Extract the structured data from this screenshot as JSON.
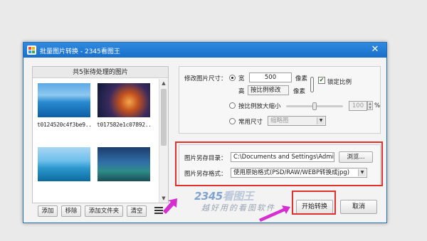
{
  "window": {
    "title": "批量图片转换 - 2345看图王",
    "close_glyph": "✕"
  },
  "file_list": {
    "header": "共5张待处理的图片",
    "items": [
      {
        "name": "t0124520c4f3be9..."
      },
      {
        "name": "t017582e1c07892..."
      },
      {
        "name": ""
      },
      {
        "name": ""
      }
    ],
    "buttons": {
      "add": "添加",
      "remove": "移除",
      "add_folder": "添加文件夹",
      "clear": "清空"
    }
  },
  "resize": {
    "label": "修改图片尺寸：",
    "width_label": "宽",
    "width_value": "500",
    "width_unit": "像素",
    "height_label": "高",
    "height_button": "按比例修改",
    "height_unit": "像素",
    "lock_ratio_label": "锁定比例",
    "lock_ratio_checked": true,
    "scale_label": "按比例放大缩小",
    "scale_value": "100",
    "scale_unit": "%",
    "scale_fraction": 0.5,
    "common_size_label": "常用尺寸",
    "common_size_value": "缩略图"
  },
  "output": {
    "dir_label": "图片另存目录：",
    "dir_value": "C:\\Documents and Settings\\Admini",
    "browse_button": "浏览...",
    "format_label": "图片另存格式：",
    "format_value": "使用原始格式(PSD/RAW/WEBP转换成jpg)"
  },
  "actions": {
    "start": "开始转换",
    "cancel": "取消"
  },
  "watermark": {
    "logo_num": "2345",
    "logo_text": "看图王",
    "slogan": "越好用的看图软件"
  },
  "colors": {
    "titlebar": "#1a6fc8",
    "highlight_red": "#e2302d",
    "arrow_magenta": "#d62fd0"
  }
}
